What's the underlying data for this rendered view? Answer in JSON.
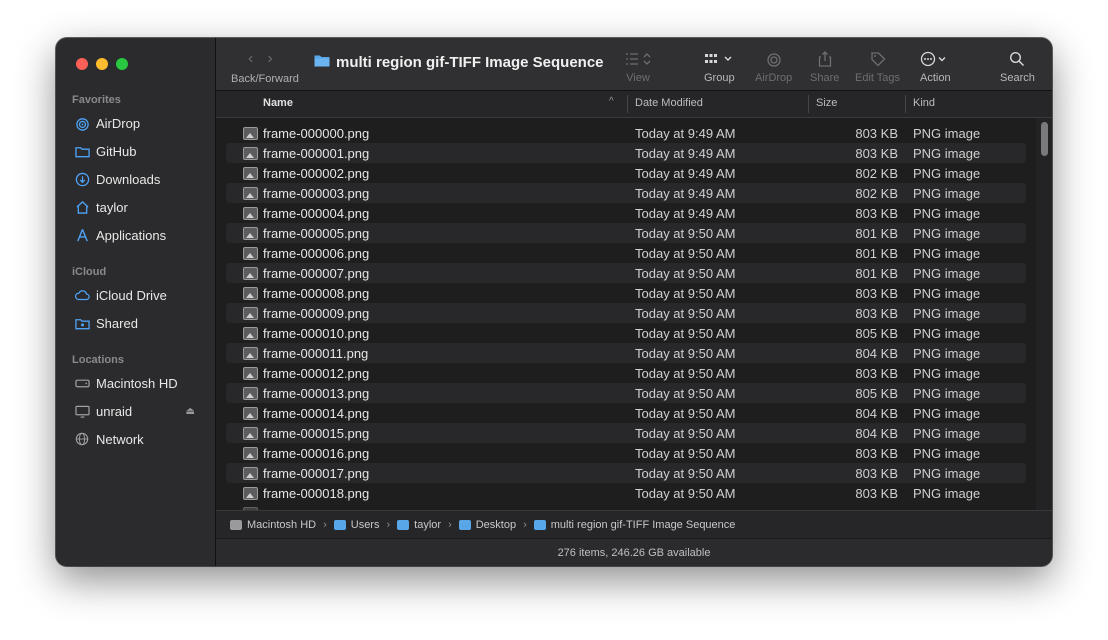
{
  "window": {
    "title": "multi region gif-TIFF Image Sequence"
  },
  "sidebar": {
    "sections": [
      {
        "label": "Favorites",
        "items": [
          {
            "label": "AirDrop",
            "icon": "airdrop-icon"
          },
          {
            "label": "GitHub",
            "icon": "folder-icon"
          },
          {
            "label": "Downloads",
            "icon": "downloads-icon"
          },
          {
            "label": "taylor",
            "icon": "home-icon"
          },
          {
            "label": "Applications",
            "icon": "applications-icon"
          }
        ]
      },
      {
        "label": "iCloud",
        "items": [
          {
            "label": "iCloud Drive",
            "icon": "icloud-icon"
          },
          {
            "label": "Shared",
            "icon": "shared-folder-icon"
          }
        ]
      },
      {
        "label": "Locations",
        "items": [
          {
            "label": "Macintosh HD",
            "icon": "hard-drive-icon"
          },
          {
            "label": "unraid",
            "icon": "display-icon"
          },
          {
            "label": "Network",
            "icon": "network-icon"
          }
        ]
      }
    ]
  },
  "toolbar": {
    "back_forward_label": "Back/Forward",
    "view_label": "View",
    "group_label": "Group",
    "airdrop_label": "AirDrop",
    "share_label": "Share",
    "edit_tags_label": "Edit Tags",
    "action_label": "Action",
    "search_label": "Search"
  },
  "columns": {
    "name": "Name",
    "date_modified": "Date Modified",
    "size": "Size",
    "kind": "Kind"
  },
  "files": [
    {
      "name": "frame-000000.png",
      "date": "Today at 9:49 AM",
      "size": "803 KB",
      "kind": "PNG image"
    },
    {
      "name": "frame-000001.png",
      "date": "Today at 9:49 AM",
      "size": "803 KB",
      "kind": "PNG image"
    },
    {
      "name": "frame-000002.png",
      "date": "Today at 9:49 AM",
      "size": "802 KB",
      "kind": "PNG image"
    },
    {
      "name": "frame-000003.png",
      "date": "Today at 9:49 AM",
      "size": "802 KB",
      "kind": "PNG image"
    },
    {
      "name": "frame-000004.png",
      "date": "Today at 9:49 AM",
      "size": "803 KB",
      "kind": "PNG image"
    },
    {
      "name": "frame-000005.png",
      "date": "Today at 9:50 AM",
      "size": "801 KB",
      "kind": "PNG image"
    },
    {
      "name": "frame-000006.png",
      "date": "Today at 9:50 AM",
      "size": "801 KB",
      "kind": "PNG image"
    },
    {
      "name": "frame-000007.png",
      "date": "Today at 9:50 AM",
      "size": "801 KB",
      "kind": "PNG image"
    },
    {
      "name": "frame-000008.png",
      "date": "Today at 9:50 AM",
      "size": "803 KB",
      "kind": "PNG image"
    },
    {
      "name": "frame-000009.png",
      "date": "Today at 9:50 AM",
      "size": "803 KB",
      "kind": "PNG image"
    },
    {
      "name": "frame-000010.png",
      "date": "Today at 9:50 AM",
      "size": "805 KB",
      "kind": "PNG image"
    },
    {
      "name": "frame-000011.png",
      "date": "Today at 9:50 AM",
      "size": "804 KB",
      "kind": "PNG image"
    },
    {
      "name": "frame-000012.png",
      "date": "Today at 9:50 AM",
      "size": "803 KB",
      "kind": "PNG image"
    },
    {
      "name": "frame-000013.png",
      "date": "Today at 9:50 AM",
      "size": "805 KB",
      "kind": "PNG image"
    },
    {
      "name": "frame-000014.png",
      "date": "Today at 9:50 AM",
      "size": "804 KB",
      "kind": "PNG image"
    },
    {
      "name": "frame-000015.png",
      "date": "Today at 9:50 AM",
      "size": "804 KB",
      "kind": "PNG image"
    },
    {
      "name": "frame-000016.png",
      "date": "Today at 9:50 AM",
      "size": "803 KB",
      "kind": "PNG image"
    },
    {
      "name": "frame-000017.png",
      "date": "Today at 9:50 AM",
      "size": "803 KB",
      "kind": "PNG image"
    },
    {
      "name": "frame-000018.png",
      "date": "Today at 9:50 AM",
      "size": "803 KB",
      "kind": "PNG image"
    }
  ],
  "pathbar": [
    {
      "label": "Macintosh HD",
      "icon": "hard-drive-icon"
    },
    {
      "label": "Users",
      "icon": "folder-icon"
    },
    {
      "label": "taylor",
      "icon": "folder-icon"
    },
    {
      "label": "Desktop",
      "icon": "folder-icon"
    },
    {
      "label": "multi region gif-TIFF Image Sequence",
      "icon": "folder-icon"
    }
  ],
  "status": {
    "text": "276 items, 246.26 GB available"
  },
  "colors": {
    "accent": "#58a6e8",
    "close": "#fe5f57",
    "minimize": "#febc2e",
    "maximize": "#28c840"
  }
}
